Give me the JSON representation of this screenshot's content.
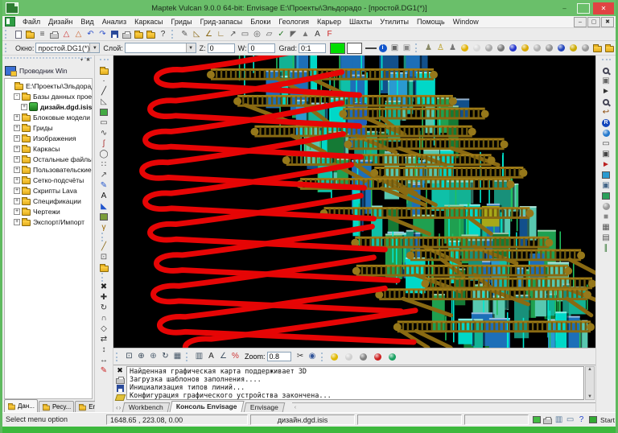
{
  "window": {
    "title": "Maptek Vulcan 9.0.0 64-bit: Envisage  E:\\Проекты\\Эльдорадо - [простой.DG1(*)]",
    "minimize": "–",
    "maximize": "",
    "close": "✕"
  },
  "menu": {
    "items": [
      "Файл",
      "Дизайн",
      "Вид",
      "Анализ",
      "Каркасы",
      "Гриды",
      "Грид-запасы",
      "Блоки",
      "Геология",
      "Карьер",
      "Шахты",
      "Утилиты",
      "Помощь",
      "Window"
    ],
    "mdi_buttons": [
      "–",
      "▢",
      "✖"
    ]
  },
  "toolbar_props": {
    "window_label": "Окно:",
    "window_value": "простой.DG1(*)",
    "layer_label": "Слой:",
    "layer_value": "",
    "z_label": "Z:",
    "z_value": "0",
    "w_label": "W:",
    "w_value": "0",
    "grad_label": "Grad:",
    "grad_value": "0:1",
    "primary_color": "#00dd00",
    "secondary_color": "#ffffff"
  },
  "icons": {
    "main": [
      {
        "n": "new-file-icon",
        "s": "page"
      },
      {
        "n": "open-file-icon",
        "s": "folder"
      },
      {
        "n": "file-list-icon",
        "g": "≡",
        "c": "#444444"
      },
      {
        "n": "print-setup-icon",
        "s": "printer"
      },
      {
        "n": "delta-open-icon",
        "g": "△",
        "c": "#cc3333"
      },
      {
        "n": "delta-close-icon",
        "g": "△",
        "c": "#cc6633"
      },
      {
        "n": "undo-icon",
        "g": "↶",
        "c": "#3355cc"
      },
      {
        "n": "redo-icon",
        "g": "↷",
        "c": "#3355cc"
      },
      {
        "n": "save-icon",
        "s": "floppy"
      },
      {
        "n": "print-icon",
        "s": "printer"
      },
      {
        "n": "archive-icon",
        "s": "folder"
      },
      {
        "n": "restore-archive-icon",
        "s": "folder"
      },
      {
        "n": "help-icon",
        "g": "?",
        "c": "#333333"
      },
      {
        "sep": true
      },
      {
        "n": "digitise-icon",
        "g": "✎",
        "c": "#555555"
      },
      {
        "n": "snap-line-icon",
        "g": "◺",
        "c": "#886611"
      },
      {
        "n": "snap-grade-icon",
        "g": "∠",
        "c": "#886611"
      },
      {
        "n": "snap-point-icon",
        "g": "∟",
        "c": "#886611"
      },
      {
        "n": "edit-line-icon",
        "g": "↗",
        "c": "#555555"
      },
      {
        "n": "select-box-icon",
        "g": "▭",
        "c": "#555555"
      },
      {
        "n": "select-circle-icon",
        "g": "◎",
        "c": "#555555"
      },
      {
        "n": "select-poly-icon",
        "g": "▱",
        "c": "#555555"
      },
      {
        "n": "query-object-icon",
        "g": "✓",
        "c": "#227722"
      },
      {
        "n": "triangle-solid-icon",
        "g": "◤",
        "c": "#666666"
      },
      {
        "n": "attribute-edit-icon",
        "g": "▲",
        "c": "#777777"
      },
      {
        "n": "text-tool-icon",
        "g": "A",
        "c": "#333333"
      },
      {
        "n": "flag-tool-icon",
        "g": "F",
        "c": "#cc2222"
      }
    ],
    "props_trailing": [
      {
        "n": "line-style-icon",
        "s": "line"
      },
      {
        "n": "info-icon",
        "s": "letterball",
        "c": "#1155cc",
        "letter": "i"
      },
      {
        "n": "layer-window-icon",
        "g": "▣",
        "c": "#666666"
      },
      {
        "n": "layer-copy-icon",
        "g": "▣",
        "c": "#888888"
      },
      {
        "sep": true
      },
      {
        "n": "marker-a-icon",
        "g": "♟",
        "c": "#888866"
      },
      {
        "n": "marker-b-icon",
        "g": "♙",
        "c": "#b09000"
      },
      {
        "n": "marker-c-icon",
        "g": "♟",
        "c": "#777777"
      },
      {
        "n": "ball-yellow-icon",
        "s": "ball",
        "c": "#e0b000"
      },
      {
        "n": "ball-white-icon",
        "s": "ball",
        "c": "#d8d8d8"
      },
      {
        "n": "ball-gray-icon",
        "s": "ball",
        "c": "#a8a8a8"
      },
      {
        "n": "ball-dark-icon",
        "s": "ball",
        "c": "#787878"
      },
      {
        "n": "ball-blue-icon",
        "s": "ball",
        "c": "#2233cc"
      },
      {
        "n": "pair-yellow-icon",
        "s": "ball",
        "c": "#d8a800"
      },
      {
        "n": "pair-silver-icon",
        "s": "ball",
        "c": "#b0b0b0"
      },
      {
        "n": "pair-gray-icon",
        "s": "ball",
        "c": "#909090"
      },
      {
        "n": "pair-blue-icon",
        "s": "ball",
        "c": "#2244bb"
      },
      {
        "n": "cyl-yellow-icon",
        "s": "ball",
        "c": "#ccaa00"
      },
      {
        "n": "cyl-gray-icon",
        "s": "ball",
        "c": "#999999"
      },
      {
        "n": "folder-cyl-icon",
        "s": "folder"
      },
      {
        "n": "folder-cyl2-icon",
        "s": "folder"
      }
    ],
    "left_strip": [
      {
        "n": "new-layer-icon",
        "s": "folder"
      },
      {
        "n": "point-tool-icon",
        "g": "·",
        "c": "#222222"
      },
      {
        "n": "line-tool-icon",
        "g": "╱",
        "c": "#222222"
      },
      {
        "n": "polyline-tool-icon",
        "g": "◺",
        "c": "#555555"
      },
      {
        "n": "image-tool-icon",
        "s": "swatch",
        "c": "#44aa44"
      },
      {
        "n": "rectangle-tool-icon",
        "g": "▭",
        "c": "#444444"
      },
      {
        "n": "curve-tool-icon",
        "g": "∿",
        "c": "#444444"
      },
      {
        "n": "spline-tool-icon",
        "g": "ʃ",
        "c": "#aa3333"
      },
      {
        "n": "ellipse-tool-icon",
        "g": "◯",
        "c": "#444444"
      },
      {
        "n": "point-grid-icon",
        "g": "∷",
        "c": "#444444"
      },
      {
        "n": "annotate-arrow-icon",
        "g": "↗",
        "c": "#555555"
      },
      {
        "n": "pen-tool-icon",
        "g": "✎",
        "c": "#2255cc"
      },
      {
        "n": "text-create-icon",
        "g": "A",
        "c": "#111111"
      },
      {
        "n": "triangle-create-icon",
        "g": "◣",
        "c": "#2255cc"
      },
      {
        "n": "fill-tool-icon",
        "s": "swatch",
        "c": "#7a9c3a"
      },
      {
        "n": "gamma-tool-icon",
        "g": "γ",
        "c": "#996600"
      },
      {
        "sep": true
      },
      {
        "n": "edit-segment-icon",
        "g": "╱",
        "c": "#886611"
      },
      {
        "n": "edit-extent-icon",
        "g": "⊡",
        "c": "#555555"
      },
      {
        "n": "layer-properties-icon",
        "s": "folder"
      },
      {
        "sep": true
      },
      {
        "n": "delete-object-icon",
        "g": "✖",
        "c": "#222222"
      },
      {
        "n": "move-object-icon",
        "g": "✚",
        "c": "#333333"
      },
      {
        "n": "rotate-object-icon",
        "g": "↻",
        "c": "#333333"
      },
      {
        "n": "arc-edit-icon",
        "g": "∩",
        "c": "#333333"
      },
      {
        "n": "vertex-edit-icon",
        "g": "◇",
        "c": "#333333"
      },
      {
        "n": "flip-object-icon",
        "g": "⇄",
        "c": "#333333"
      },
      {
        "n": "stretch-object-icon",
        "g": "↕",
        "c": "#333333"
      },
      {
        "n": "extend-object-icon",
        "g": "↔",
        "c": "#333333"
      },
      {
        "n": "pen-red-icon",
        "g": "✎",
        "c": "#cc2222"
      }
    ],
    "right_strip": [
      {
        "n": "zoom-tool-icon",
        "s": "mag"
      },
      {
        "n": "link-views-icon",
        "g": "▣",
        "c": "#666666"
      },
      {
        "n": "pick-tool-icon",
        "g": "►",
        "c": "#333333"
      },
      {
        "n": "zoom-select-icon",
        "s": "mag"
      },
      {
        "n": "view-previous-icon",
        "g": "↩",
        "c": "#884400"
      },
      {
        "n": "refresh-view-icon",
        "s": "letterball",
        "c": "#1144bb",
        "letter": "R"
      },
      {
        "n": "world-view-icon",
        "s": "ball",
        "c": "#2277cc"
      },
      {
        "n": "new-window-icon",
        "g": "▭",
        "c": "#444444"
      },
      {
        "n": "cascade-windows-icon",
        "g": "▣",
        "c": "#444444"
      },
      {
        "n": "redraw-icon",
        "g": "►",
        "c": "#bb2222"
      },
      {
        "n": "screen-display-icon",
        "s": "swatch",
        "c": "#2a9ad0"
      },
      {
        "n": "window-restore-icon",
        "g": "▣",
        "c": "#446688"
      },
      {
        "n": "screen-green-icon",
        "s": "swatch",
        "c": "#2aa05a"
      },
      {
        "n": "spheres-icon",
        "s": "ball",
        "c": "#999999"
      },
      {
        "n": "cube-icon",
        "g": "■",
        "c": "#888888"
      },
      {
        "n": "grid-view-icon",
        "g": "▦",
        "c": "#555555"
      },
      {
        "n": "grid-plane-icon",
        "g": "▤",
        "c": "#555555"
      },
      {
        "n": "slice-icon",
        "g": "∥",
        "c": "#337733"
      }
    ],
    "view_left": [
      {
        "n": "select-region-icon",
        "g": "⊡",
        "c": "#334455"
      },
      {
        "n": "pan-view-icon",
        "g": "⊕",
        "c": "#334455"
      },
      {
        "n": "center-view-icon",
        "g": "⊕",
        "c": "#556677"
      },
      {
        "n": "rotate-view-icon",
        "g": "↻",
        "c": "#334455"
      },
      {
        "n": "table-view-icon",
        "g": "▦",
        "c": "#445566"
      }
    ],
    "view_mid": [
      {
        "n": "section-view-icon",
        "g": "▥",
        "c": "#445566"
      },
      {
        "n": "text-size-icon",
        "g": "A",
        "c": "#222222"
      },
      {
        "n": "angle-measure-icon",
        "g": "∠",
        "c": "#445566"
      },
      {
        "n": "strike-dip-icon",
        "g": "%",
        "c": "#cc3333"
      }
    ],
    "view_right": [
      {
        "n": "scissors-icon",
        "g": "✂",
        "c": "#333333"
      },
      {
        "n": "snapshot-icon",
        "g": "◉",
        "c": "#335599"
      }
    ],
    "view_balls": [
      {
        "n": "lamp-yellow-icon",
        "s": "ball",
        "c": "#e0b800"
      },
      {
        "n": "lamp-white-icon",
        "s": "ball",
        "c": "#d0d0d0"
      },
      {
        "n": "lamp-gray-icon",
        "s": "ball",
        "c": "#808080"
      },
      {
        "n": "lamp-red-icon",
        "s": "ball",
        "c": "#cc2020"
      },
      {
        "n": "lamp-green-icon",
        "s": "ball",
        "c": "#18a060"
      }
    ],
    "console_side": [
      {
        "n": "close-console-icon",
        "g": "✖",
        "c": "#111111"
      },
      {
        "n": "print-console-icon",
        "s": "printer"
      },
      {
        "n": "save-console-icon",
        "s": "floppy"
      },
      {
        "n": "clear-console-icon",
        "s": "eraser"
      }
    ],
    "status_right": [
      {
        "n": "edit-status-icon",
        "s": "swatch",
        "c": "#44bb44"
      },
      {
        "n": "print-status-icon",
        "s": "printer"
      },
      {
        "n": "tile-windows-icon",
        "g": "▥",
        "c": "#557799"
      },
      {
        "n": "minimize-all-icon",
        "g": "▭",
        "c": "#557799"
      },
      {
        "n": "help-book-icon",
        "g": "?",
        "c": "#2244cc"
      },
      {
        "n": "start-logo-icon",
        "s": "swatch",
        "c": "#33aa33"
      }
    ]
  },
  "explorer": {
    "title": "Проводник Win",
    "grip_buttons": [
      "▾",
      "✖"
    ],
    "tree": [
      {
        "label": "E:\\Проекты\\Эльдорадо",
        "depth": 0,
        "icon": "folder",
        "exp": ""
      },
      {
        "label": "Базы данных проекта",
        "depth": 1,
        "icon": "folder",
        "exp": "-"
      },
      {
        "label": "дизайн.dgd.isis",
        "depth": 2,
        "icon": "db",
        "exp": "+",
        "bold": true
      },
      {
        "label": "Блоковые модели",
        "depth": 1,
        "icon": "folder",
        "exp": "+"
      },
      {
        "label": "Гриды",
        "depth": 1,
        "icon": "folder",
        "exp": "+"
      },
      {
        "label": "Изображения",
        "depth": 1,
        "icon": "folder",
        "exp": "+"
      },
      {
        "label": "Каркасы",
        "depth": 1,
        "icon": "folder",
        "exp": "+"
      },
      {
        "label": "Остальные файлы",
        "depth": 1,
        "icon": "folder",
        "exp": "+"
      },
      {
        "label": "Пользовательские БД",
        "depth": 1,
        "icon": "folder",
        "exp": "+"
      },
      {
        "label": "Сетко-подсчёты",
        "depth": 1,
        "icon": "folder",
        "exp": "+"
      },
      {
        "label": "Скрипты Lava",
        "depth": 1,
        "icon": "folder",
        "exp": "+"
      },
      {
        "label": "Спецификации",
        "depth": 1,
        "icon": "folder",
        "exp": "+"
      },
      {
        "label": "Чертежи",
        "depth": 1,
        "icon": "folder",
        "exp": "+"
      },
      {
        "label": "Экспорт/Импорт",
        "depth": 1,
        "icon": "folder",
        "exp": "+"
      }
    ],
    "tabs": [
      {
        "label": "Дан...",
        "active": true
      },
      {
        "label": "Ресу...",
        "active": false
      },
      {
        "label": "Envis...",
        "active": false
      }
    ]
  },
  "view_toolbar": {
    "zoom_label": "Zoom:",
    "zoom_value": "0.8"
  },
  "console": {
    "lines": [
      "Найденная графическая карта поддерживает 3D",
      "Загрузка шаблонов заполнения....",
      "Инициализация типов линий...",
      "Конфигурация графического устройства закончена..."
    ],
    "tab_arrows": [
      "‹",
      "›"
    ],
    "tabs": [
      {
        "label": "Workbench",
        "active": false
      },
      {
        "label": "Консоль Envisage",
        "active": true
      },
      {
        "label": "Envisage",
        "active": false
      }
    ],
    "hscroll_arrow": "‹"
  },
  "statusbar": {
    "message": "Select menu option",
    "coordinates": "1648.65 , 223.08, 0.00",
    "field2": "",
    "file": "дизайн.dgd.isis",
    "field4": "",
    "start_label": "Start"
  },
  "scene": {
    "background": "#000000",
    "ramp_color": "#e60505",
    "drive_color": "#8a6a12",
    "block_palette": [
      "#12b294",
      "#00d8c8",
      "#1fa050",
      "#157a35",
      "#1d6fb8",
      "#2a9ad0",
      "#12508c",
      "#58c8b0",
      "#18907a",
      "#0fc0a8"
    ]
  }
}
